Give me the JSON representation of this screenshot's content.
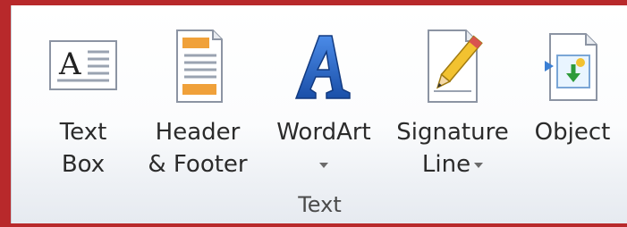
{
  "ribbon": {
    "group_label": "Text",
    "commands": [
      {
        "id": "text-box",
        "line1": "Text",
        "line2": "Box",
        "icon": "text-box-icon"
      },
      {
        "id": "header-footer",
        "line1": "Header",
        "line2": "& Footer",
        "icon": "header-footer-icon"
      },
      {
        "id": "wordart",
        "line1": "WordArt",
        "line2": "",
        "icon": "wordart-icon",
        "has_dropdown": true
      },
      {
        "id": "signature-line",
        "line1": "Signature",
        "line2": "Line",
        "icon": "signature-line-icon",
        "has_dropdown": true
      },
      {
        "id": "object",
        "line1": "Object",
        "line2": "",
        "icon": "object-icon"
      }
    ]
  },
  "colors": {
    "frame_border": "#b8292b",
    "background_left": "#1c2a5c",
    "wordart_blue": "#1f63c7",
    "object_green": "#2e9b3a"
  }
}
